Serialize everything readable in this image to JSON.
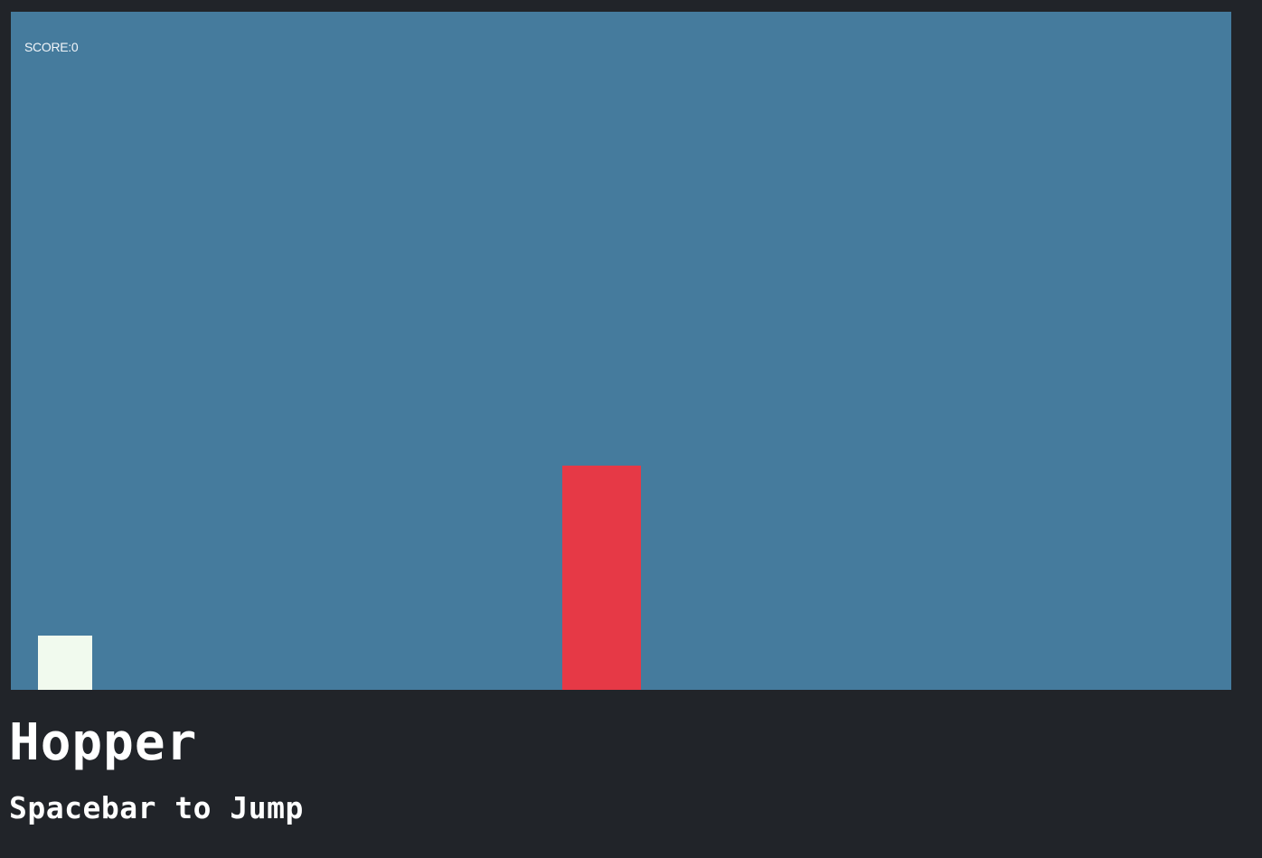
{
  "game": {
    "score_text": "SCORE:0",
    "score": 0
  },
  "colors": {
    "page_background": "#212429",
    "canvas_background": "#457b9d",
    "player": "#f1faee",
    "obstacle": "#e63946",
    "text": "#ffffff"
  },
  "info": {
    "title": "Hopper",
    "instructions": "Spacebar to Jump"
  }
}
